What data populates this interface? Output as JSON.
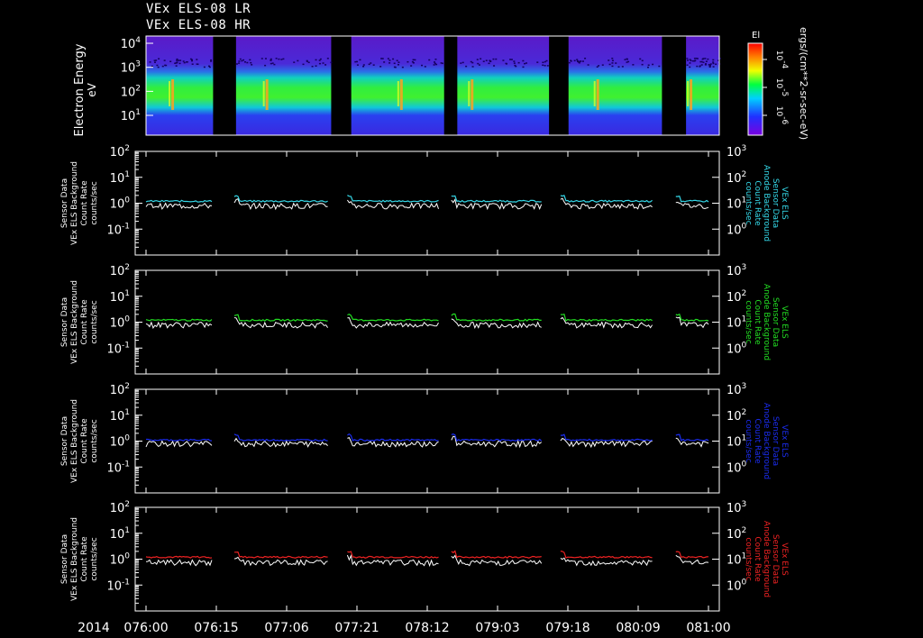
{
  "titles": [
    "VEx ELS-08 LR",
    "VEx ELS-08 HR"
  ],
  "time_axis": {
    "year": "2014",
    "ticks": [
      "076:00",
      "076:15",
      "077:06",
      "077:21",
      "078:12",
      "079:03",
      "079:18",
      "080:09",
      "081:00"
    ]
  },
  "spectrogram": {
    "ylabel": "Electron Energy",
    "yunit": "eV",
    "yticks": [
      "10",
      "10",
      "10",
      "10"
    ],
    "yticks_exp": [
      "1",
      "2",
      "3",
      "4"
    ],
    "colorbar_label": "El",
    "colorbar_unit": "ergs/(cm**2-sr-sec-eV)",
    "colorbar_ticks": [
      "10",
      "10",
      "10"
    ],
    "colorbar_ticks_exp": [
      "-4",
      "-5",
      "-6"
    ],
    "gaps_note": ""
  },
  "panels": [
    {
      "left_label": [
        "Sensor Data",
        "VEx ELS Background",
        "Count Rate",
        "counts/sec"
      ],
      "right_label": [
        "VEx ELS",
        "Sensor Data",
        "Anode Background",
        "Count Rate",
        "counts/sec"
      ],
      "color": "#34d8e8"
    },
    {
      "left_label": [
        "Sensor Data",
        "VEx ELS Background",
        "Count Rate",
        "counts/sec"
      ],
      "right_label": [
        "VEx ELS",
        "Sensor Data",
        "Anode Background",
        "Count Rate",
        "counts/sec"
      ],
      "color": "#22dd22"
    },
    {
      "left_label": [
        "Sensor Data",
        "VEx ELS Background",
        "Count Rate",
        "counts/sec"
      ],
      "right_label": [
        "VEx ELS",
        "Sensor Data",
        "Anode Background",
        "Count Rate",
        "counts/sec"
      ],
      "color": "#1a2cf0"
    },
    {
      "left_label": [
        "Sensor Data",
        "VEx ELS Background",
        "Count Rate",
        "counts/sec"
      ],
      "right_label": [
        "VEx ELS",
        "Sensor Data",
        "Anode Background",
        "Count Rate",
        "counts/sec"
      ],
      "color": "#ee2222"
    }
  ],
  "left_yticks": [
    "10",
    "10",
    "10",
    "10"
  ],
  "left_yticks_exp": [
    "2",
    "1",
    "0",
    "-1"
  ],
  "right_yticks": [
    "10",
    "10",
    "10",
    "10"
  ],
  "right_yticks_exp": [
    "3",
    "2",
    "1",
    "0"
  ],
  "chart_data": {
    "type": "line",
    "x_range": [
      "076:00",
      "081:00"
    ],
    "data_segments": [
      [
        0.0,
        0.117
      ],
      [
        0.157,
        0.323
      ],
      [
        0.358,
        0.52
      ],
      [
        0.543,
        0.703
      ],
      [
        0.737,
        0.9
      ],
      [
        0.942,
        1.0
      ]
    ],
    "series": [
      {
        "name": "",
        "color": "#34d8e8",
        "colored_level": 1.2,
        "white_level": 0.8
      },
      {
        "name": "",
        "color": "#22dd22",
        "colored_level": 1.2,
        "white_level": 0.8
      },
      {
        "name": "",
        "color": "#1a2cf0",
        "colored_level": 1.1,
        "white_level": 0.8
      },
      {
        "name": "",
        "color": "#ee2222",
        "colored_level": 1.2,
        "white_level": 0.75
      }
    ],
    "left_ylim": [
      0.01,
      100
    ],
    "right_ylim": [
      0.1,
      1000
    ],
    "spectrogram_ylim_eV": [
      1.5,
      20000
    ],
    "log_scale": true
  }
}
